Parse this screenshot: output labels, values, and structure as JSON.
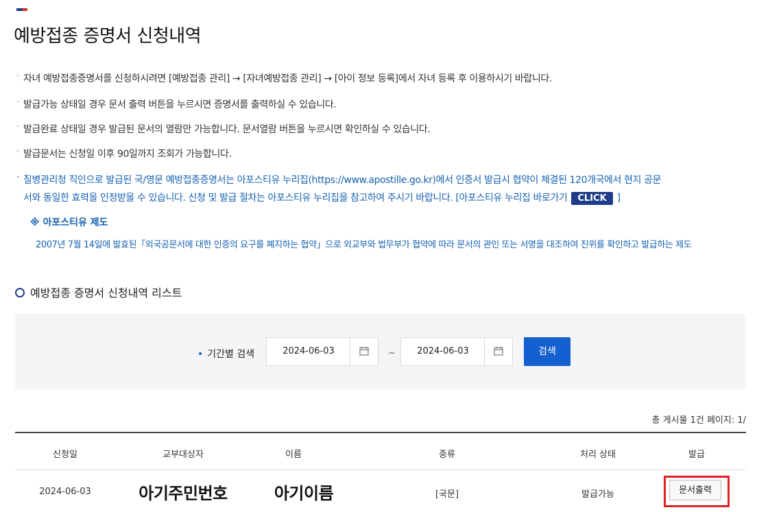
{
  "page": {
    "title": "예방접종 증명서 신청내역",
    "accent_colors": {
      "navy": "#1f3c88",
      "red": "#d62d2d"
    }
  },
  "notes": [
    "자녀 예방접종증명서를 신청하시려면 [예방접종 관리] → [자녀예방접종 관리] → [아이 정보 등록]에서 자녀 등록 후 이용하시기 바랍니다.",
    "발급가능 상태일 경우 문서 출력 버튼을 누르시면 증명서를 출력하실 수 있습니다.",
    "발급완료 상태일 경우 발급된 문서의 열람만 가능합니다. 문서열람 버튼을 누르시면 확인하실 수 있습니다.",
    "발급문서는 신청일 이후 90일까지 조회가 가능합니다."
  ],
  "apostille_notice": {
    "line1": "질병관리청 직인으로 발급된 국/영문 예방접종증명서는 아포스티유 누리집(https://www.apostille.go.kr)에서 인증서 발급시 협약이 체결된 120개국에서 현지 공문",
    "line2_prefix": "서와 동일한 효력을 인정받을 수 있습니다. 신청 및 발급 절차는 아포스티유 누리집을 참고하여 주시기 바랍니다. [아포스티유 누리집 바로가기",
    "click_label": "CLICK",
    "line2_suffix": "]",
    "system_title": "※ 아포스티유 제도",
    "system_desc": "2007년 7월 14일에 발효된「외국공문서에 대한 인증의 요구를 폐지하는 협약」으로 외교부와 법무부가 협약에 따라 문서의 관인 또는 서명을 대조하여 진위를 확인하고 발급하는 제도"
  },
  "list_section": {
    "title": "예방접종 증명서 신청내역 리스트"
  },
  "search": {
    "label": "기간별 검색",
    "start_date": "2024-06-03",
    "end_date": "2024-06-03",
    "separator": "~",
    "button_label": "검색",
    "button_color": "#1560d0"
  },
  "summary": {
    "text": "총 게시물 1건   페이지: 1/"
  },
  "table": {
    "headers": [
      "신청일",
      "교부대상자",
      "이름",
      "종류",
      "처리 상태",
      "발급"
    ],
    "rows": [
      {
        "date": "2024-06-03",
        "recipient": "아기주민번호",
        "name": "아기이름",
        "type": "[국문]",
        "status": "발급가능",
        "action_label": "문서출력"
      }
    ]
  }
}
